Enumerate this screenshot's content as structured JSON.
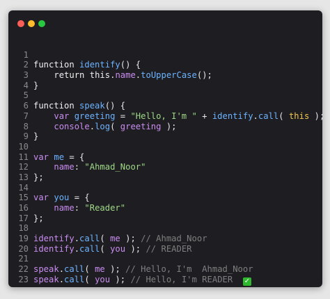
{
  "window": {
    "controls": [
      "close",
      "minimize",
      "maximize"
    ]
  },
  "colors": {
    "background": "#1e1e22",
    "keyword": "#f0f0f0",
    "function": "#6db3ff",
    "property": "#c98cf0",
    "string": "#9fd987",
    "comment": "#7f7f7f",
    "this": "#f2c94c"
  },
  "code": {
    "line_numbers": [
      "1",
      "2",
      "3",
      "4",
      "5",
      "6",
      "7",
      "8",
      "9",
      "10",
      "11",
      "12",
      "13",
      "14",
      "15",
      "16",
      "17",
      "18",
      "19",
      "20",
      "21",
      "22",
      "23"
    ],
    "l1": {
      "kw": "function ",
      "fn": "identify",
      "rest": "() {"
    },
    "l2": {
      "indent": "    ",
      "kw": "return ",
      "this": "this",
      "dot1": ".",
      "prop": "name",
      "dot2": ".",
      "fn": "toUpperCase",
      "rest": "();"
    },
    "l3": {
      "rest": "}"
    },
    "l5": {
      "kw": "function ",
      "fn": "speak",
      "rest": "() {"
    },
    "l6": {
      "indent": "    ",
      "kw": "var ",
      "var": "greeting",
      "eq": " = ",
      "str": "\"Hello, I'm \"",
      "plus": " + ",
      "fn": "identify",
      "dot": ".",
      "call": "call",
      "open": "( ",
      "this": "this",
      "close": " );"
    },
    "l7": {
      "indent": "    ",
      "obj": "console",
      "dot": ".",
      "fn": "log",
      "open": "( ",
      "arg": "greeting",
      "close": " );"
    },
    "l8": {
      "rest": "}"
    },
    "l10": {
      "kw": "var ",
      "var": "me",
      "rest": " = {"
    },
    "l11": {
      "indent": "    ",
      "prop": "name",
      "colon": ": ",
      "str": "\"Ahmad_Noor\""
    },
    "l12": {
      "rest": "};"
    },
    "l14": {
      "kw": "var ",
      "var": "you",
      "rest": " = {"
    },
    "l15": {
      "indent": "    ",
      "prop": "name",
      "colon": ": ",
      "str": "\"Reader\""
    },
    "l16": {
      "rest": "};"
    },
    "l18": {
      "fn": "identify",
      "dot": ".",
      "call": "call",
      "open": "( ",
      "arg": "me",
      "close": " ); ",
      "cmt": "// Ahmad_Noor"
    },
    "l19": {
      "fn": "identify",
      "dot": ".",
      "call": "call",
      "open": "( ",
      "arg": "you",
      "close": " ); ",
      "cmt": "// READER"
    },
    "l21": {
      "fn": "speak",
      "dot": ".",
      "call": "call",
      "open": "( ",
      "arg": "me",
      "close": " ); ",
      "cmt": "// Hello, I'm  Ahmad_Noor"
    },
    "l22": {
      "fn": "speak",
      "dot": ".",
      "call": "call",
      "open": "( ",
      "arg": "you",
      "close": " ); ",
      "cmt": "// Hello, I'm READER  ",
      "emoji": "✓"
    }
  }
}
